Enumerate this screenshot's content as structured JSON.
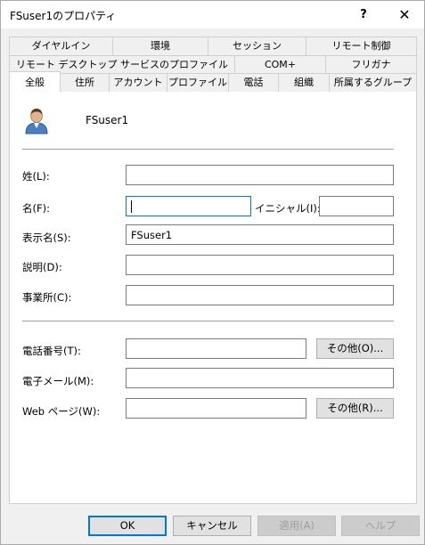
{
  "window": {
    "title": "FSuser1のプロパティ",
    "help_symbol": "?",
    "close_symbol": "✕"
  },
  "tabs": {
    "row1": [
      "ダイヤルイン",
      "環境",
      "セッション",
      "リモート制御"
    ],
    "row2": [
      "リモート デスクトップ サービスのプロファイル",
      "COM+",
      "フリガナ"
    ],
    "row3": [
      "全般",
      "住所",
      "アカウント",
      "プロファイル",
      "電話",
      "組織",
      "所属するグループ"
    ],
    "active": "全般"
  },
  "general": {
    "user_icon": "user-icon",
    "username": "FSuser1",
    "last_name_label": "姓(L):",
    "last_name_value": "",
    "first_name_label": "名(F):",
    "first_name_value": "",
    "initials_label": "イニシャル(I):",
    "initials_value": "",
    "display_name_label": "表示名(S):",
    "display_name_value": "FSuser1",
    "description_label": "説明(D):",
    "description_value": "",
    "office_label": "事業所(C):",
    "office_value": "",
    "phone_label": "電話番号(T):",
    "phone_value": "",
    "phone_other_button": "その他(O)...",
    "email_label": "電子メール(M):",
    "email_value": "",
    "web_label": "Web ページ(W):",
    "web_value": "",
    "web_other_button": "その他(R)..."
  },
  "footer": {
    "ok": "OK",
    "cancel": "キャンセル",
    "apply": "適用(A)",
    "help": "ヘルプ"
  },
  "colors": {
    "accent": "#0078d7",
    "panel": "#ffffff",
    "background": "#f0f0f0"
  }
}
